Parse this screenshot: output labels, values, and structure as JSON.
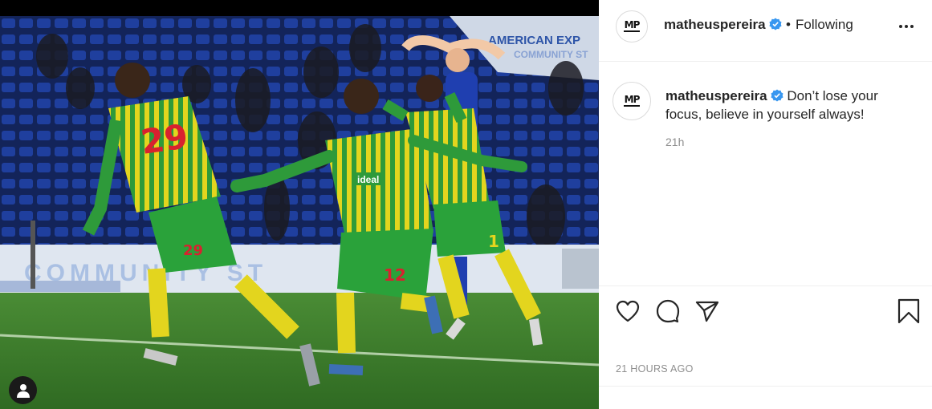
{
  "post": {
    "username": "matheuspereira",
    "separator": "•",
    "follow_label": "Following",
    "avatar_text": "MP",
    "caption_text": "Don’t lose your focus, believe in yourself always!",
    "caption_time": "21h",
    "timestamp": "21 HOURS AGO"
  },
  "photo": {
    "banner_text": "AMERICAN EXP",
    "banner_text_2": "COMMUNITY ST",
    "board_text": "COMMUNITY ST",
    "jersey_left": "29",
    "jersey_center": "12",
    "jersey_right": "1",
    "shorts_left": "29",
    "shorts_center": "12",
    "sponsor": "ideal"
  },
  "icons": {
    "like": "heart-icon",
    "comment": "comment-icon",
    "share": "paper-plane-icon",
    "save": "bookmark-icon",
    "more": "ellipsis-icon",
    "tags": "user-tag-icon",
    "verified": "verified-badge-icon"
  },
  "colors": {
    "verified": "#3897f0",
    "kit_green": "#2e9a3a",
    "kit_yellow": "#e8d424",
    "pitch": "#3f7e2c"
  }
}
